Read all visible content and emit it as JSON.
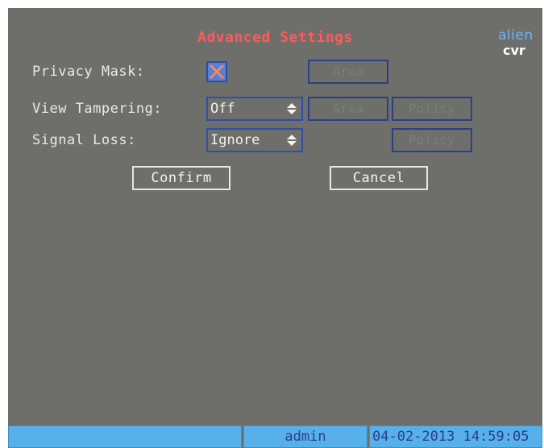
{
  "dialog": {
    "title": "Advanced Settings",
    "logo_top": "alien",
    "logo_bottom": "cvr"
  },
  "privacy_mask": {
    "label": "Privacy Mask:",
    "checked": true,
    "area_label": "Area"
  },
  "view_tampering": {
    "label": "View Tampering:",
    "value": "Off",
    "area_label": "Area",
    "policy_label": "Policy"
  },
  "signal_loss": {
    "label": "Signal Loss:",
    "value": "Ignore",
    "policy_label": "Policy"
  },
  "buttons": {
    "confirm": "Confirm",
    "cancel": "Cancel"
  },
  "status": {
    "user": "admin",
    "datetime": "04-02-2013 14:59:05"
  },
  "colors": {
    "screen_bg": "#6e6f6b",
    "title": "#ff5a5a",
    "statusbar": "#57b0ea",
    "selected_border": "#2f4ea6"
  }
}
